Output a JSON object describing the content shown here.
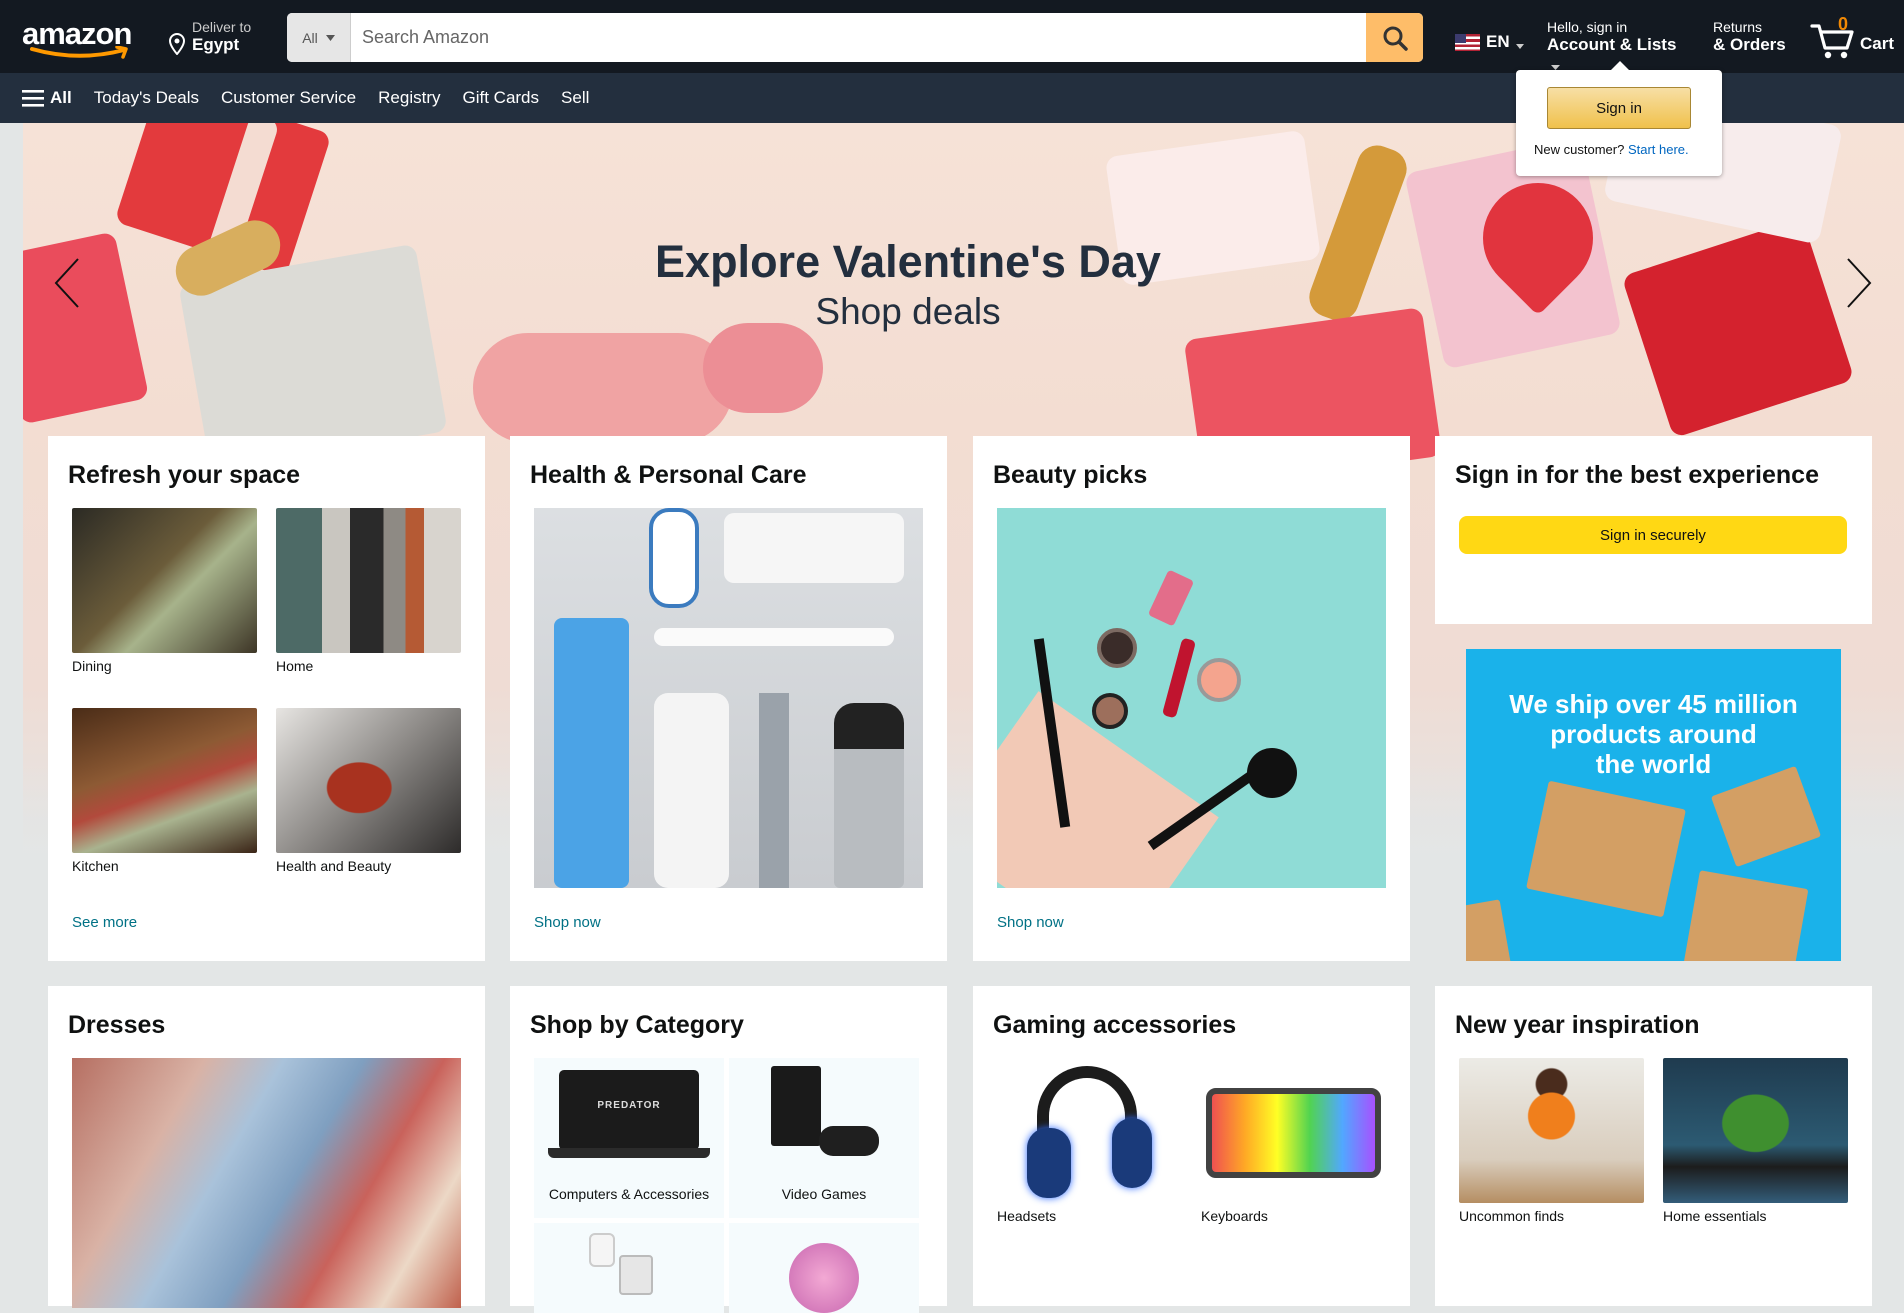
{
  "nav": {
    "logo": "amazon",
    "deliver_line1": "Deliver to",
    "deliver_line2": "Egypt",
    "search_category": "All",
    "search_placeholder": "Search Amazon",
    "language": "EN",
    "account_line1": "Hello, sign in",
    "account_line2": "Account & Lists",
    "returns_line1": "Returns",
    "returns_line2": "& Orders",
    "cart_count": "0",
    "cart_label": "Cart",
    "menu": [
      "All",
      "Today's Deals",
      "Customer Service",
      "Registry",
      "Gift Cards",
      "Sell"
    ]
  },
  "popover": {
    "sign_in": "Sign in",
    "new_customer": "New customer?",
    "start_here": "Start here."
  },
  "hero": {
    "title": "Explore Valentine's Day",
    "subtitle": "Shop deals"
  },
  "cards": {
    "refresh": {
      "title": "Refresh your space",
      "tiles": [
        "Dining",
        "Home",
        "Kitchen",
        "Health and Beauty"
      ],
      "link": "See more"
    },
    "health": {
      "title": "Health & Personal Care",
      "link": "Shop now"
    },
    "beauty": {
      "title": "Beauty picks",
      "link": "Shop now"
    },
    "signin": {
      "title": "Sign in for the best experience",
      "button": "Sign in securely"
    },
    "ship": {
      "line1": "We ship over 45 million",
      "line2": "products around",
      "line3": "the world"
    },
    "dresses": {
      "title": "Dresses"
    },
    "category": {
      "title": "Shop by Category",
      "cells": [
        "Computers & Accessories",
        "Video Games"
      ],
      "laptop_brand": "PREDATOR"
    },
    "gaming": {
      "title": "Gaming accessories",
      "tiles": [
        "Headsets",
        "Keyboards"
      ]
    },
    "newyear": {
      "title": "New year inspiration",
      "tiles": [
        "Uncommon finds",
        "Home essentials"
      ]
    }
  },
  "colors": {
    "nav_top": "#131921",
    "nav_bottom": "#232f3e",
    "search_button": "#febd69",
    "link": "#007185",
    "sign_in_yellow": "#ffd814",
    "ship_blue": "#1ab2ea"
  }
}
